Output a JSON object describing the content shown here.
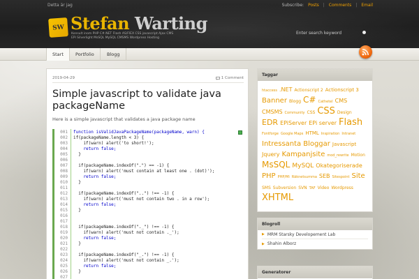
{
  "header": {
    "topbar_left": "Detta är jag",
    "subscribe_label": "Subscribe:",
    "subscribe_posts": "Posts",
    "subscribe_comments": "Comments",
    "subscribe_email": "Email",
    "logo_mark": "SW",
    "logo_first": "Stefan",
    "logo_last": "Warting",
    "tagline": "Konsult inom PHP C#.NET Flash AS/FlEX CSS javascript Ajax CMS EPi Silverlight MsSQL MySQL CMSMS Wordpress Hosting",
    "search_placeholder": "Enter search keyword"
  },
  "nav": {
    "items": [
      "Start",
      "Portfolio",
      "Blogg"
    ]
  },
  "post": {
    "date": "2019-04-29",
    "comments": "1 Comment",
    "title": "Simple javascript to validate java packageName",
    "excerpt": "Here is a simple javascript that validates a java package name",
    "code_lines": [
      {
        "n": "001",
        "t": "function isValidJavaPackageName(packageName, warn) {"
      },
      {
        "n": "002",
        "t": "if(packageName.length < 3) {"
      },
      {
        "n": "003",
        "t": "    if(warn) alert('to short!');"
      },
      {
        "n": "004",
        "t": "    return false;"
      },
      {
        "n": "005",
        "t": "  }"
      },
      {
        "n": "006",
        "t": ""
      },
      {
        "n": "007",
        "t": "  if(packageName.indexOf(\".\") == -1) {"
      },
      {
        "n": "008",
        "t": "    if(warn) alert('must contain at least one . (dot)');"
      },
      {
        "n": "009",
        "t": "    return false;"
      },
      {
        "n": "010",
        "t": "  }"
      },
      {
        "n": "011",
        "t": ""
      },
      {
        "n": "012",
        "t": "  if(packageName.indexOf(\"..\") !== -1) {"
      },
      {
        "n": "013",
        "t": "    if(warn) alert('must not contain two . in a row');"
      },
      {
        "n": "014",
        "t": "    return false;"
      },
      {
        "n": "015",
        "t": "  }"
      },
      {
        "n": "016",
        "t": ""
      },
      {
        "n": "017",
        "t": ""
      },
      {
        "n": "018",
        "t": "  if(packageName.indexOf(\"._\") !== -1) {"
      },
      {
        "n": "019",
        "t": "    if(warn) alert('must not contain ._');"
      },
      {
        "n": "020",
        "t": "    return false;"
      },
      {
        "n": "021",
        "t": "  }"
      },
      {
        "n": "022",
        "t": ""
      },
      {
        "n": "023",
        "t": "  if(packageName.indexOf(\"_.\") !== -1) {"
      },
      {
        "n": "024",
        "t": "    if(warn) alert('must not contain _.');"
      },
      {
        "n": "025",
        "t": "    return false;"
      },
      {
        "n": "026",
        "t": "  }"
      },
      {
        "n": "027",
        "t": ""
      },
      {
        "n": "028",
        "t": "  if(packageName.indexOf(\"__\") !== -1) {"
      }
    ]
  },
  "sidebar": {
    "tags_title": "Taggar",
    "tags": [
      {
        "t": "htaccess",
        "s": 5
      },
      {
        "t": ".NET",
        "s": 8
      },
      {
        "t": "Actionscript 2",
        "s": 6
      },
      {
        "t": "Actionscript 3",
        "s": 7
      },
      {
        "t": "Banner",
        "s": 10
      },
      {
        "t": "Blogg",
        "s": 6
      },
      {
        "t": "C#",
        "s": 12
      },
      {
        "t": "Cathetel",
        "s": 5
      },
      {
        "t": "CMS",
        "s": 8
      },
      {
        "t": "CMSMS",
        "s": 8
      },
      {
        "t": "Community",
        "s": 5
      },
      {
        "t": "CSS",
        "s": 6
      },
      {
        "t": "CSS",
        "s": 13
      },
      {
        "t": "Design",
        "s": 6
      },
      {
        "t": "EDR",
        "s": 11
      },
      {
        "t": "EPiServer",
        "s": 8
      },
      {
        "t": "EPi server",
        "s": 8
      },
      {
        "t": "Flash",
        "s": 13
      },
      {
        "t": "Fontforge",
        "s": 5
      },
      {
        "t": "Google Maps",
        "s": 5
      },
      {
        "t": "HTML",
        "s": 7
      },
      {
        "t": "Inspiration",
        "s": 5
      },
      {
        "t": "Intranet",
        "s": 5
      },
      {
        "t": "Intressanta",
        "s": 10
      },
      {
        "t": "Bloggar",
        "s": 10
      },
      {
        "t": "Javascript",
        "s": 7
      },
      {
        "t": "Jquery",
        "s": 8
      },
      {
        "t": "Kampanjsite",
        "s": 10
      },
      {
        "t": "mod_rewrite",
        "s": 5
      },
      {
        "t": "Motion",
        "s": 6
      },
      {
        "t": "MsSQL",
        "s": 12
      },
      {
        "t": "MySQL",
        "s": 9
      },
      {
        "t": "Okategoriserade",
        "s": 8
      },
      {
        "t": "PHP",
        "s": 10
      },
      {
        "t": "PHP/Mi",
        "s": 5
      },
      {
        "t": "Räknetsumma",
        "s": 5
      },
      {
        "t": "SEB",
        "s": 8
      },
      {
        "t": "Sitespoint",
        "s": 5
      },
      {
        "t": "Site",
        "s": 10
      },
      {
        "t": "SMS",
        "s": 6
      },
      {
        "t": "Subversion",
        "s": 6
      },
      {
        "t": "SVN",
        "s": 6
      },
      {
        "t": "TAF",
        "s": 5
      },
      {
        "t": "Video",
        "s": 6
      },
      {
        "t": "Wordpress",
        "s": 6
      },
      {
        "t": "XHTML",
        "s": 13
      }
    ],
    "blogroll_title": "Blogroll",
    "blogroll": [
      "MRM Starsky Developement Lab",
      "Shahin Alborz"
    ],
    "generators_title": "Generatorer"
  },
  "colors": {
    "accent": "#f0a000",
    "tag": "#e69900"
  }
}
